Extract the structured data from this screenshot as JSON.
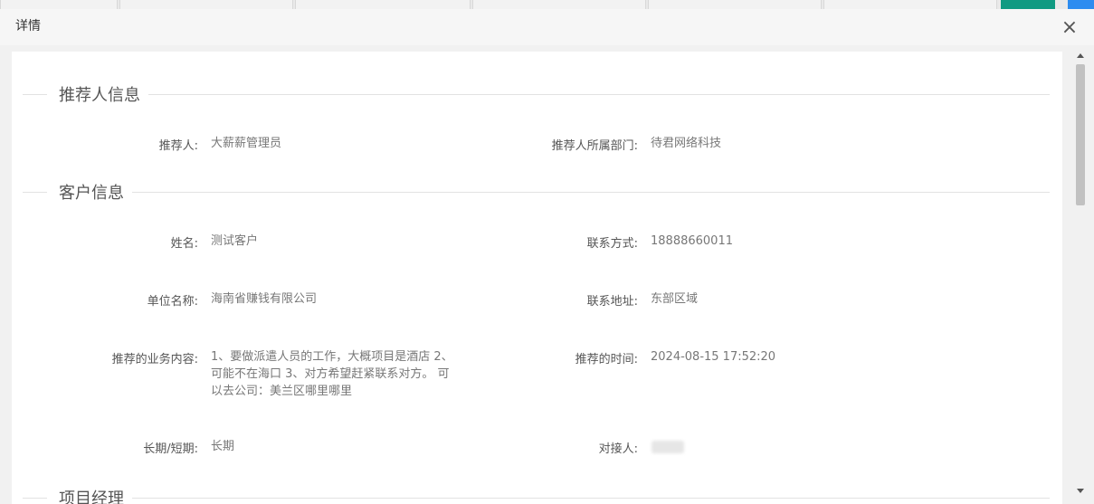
{
  "modal": {
    "title": "详情",
    "close_symbol": "×"
  },
  "sections": {
    "referrer": {
      "title": "推荐人信息",
      "fields": {
        "referrer_label": "推荐人:",
        "referrer_value": "大薪薪管理员",
        "dept_label": "推荐人所属部门:",
        "dept_value": "待君网络科技"
      }
    },
    "customer": {
      "title": "客户信息",
      "fields": {
        "name_label": "姓名:",
        "name_value": "测试客户",
        "contact_label": "联系方式:",
        "contact_value": "18888660011",
        "company_label": "单位名称:",
        "company_value": "海南省赚钱有限公司",
        "address_label": "联系地址:",
        "address_value": "东部区域",
        "business_label": "推荐的业务内容:",
        "business_value_line1": "1、要做派遣人员的工作，大概项目是酒店 2、",
        "business_value_line2": "可能不在海口 3、对方希望赶紧联系对方。 可",
        "business_value_line3": "以去公司：美兰区哪里哪里",
        "time_label": "推荐的时间:",
        "time_value": "2024-08-15 17:52:20",
        "term_label": "长期/短期:",
        "term_value": "长期",
        "liaison_label": "对接人:"
      }
    },
    "next_section": {
      "title": "项目经理"
    }
  }
}
